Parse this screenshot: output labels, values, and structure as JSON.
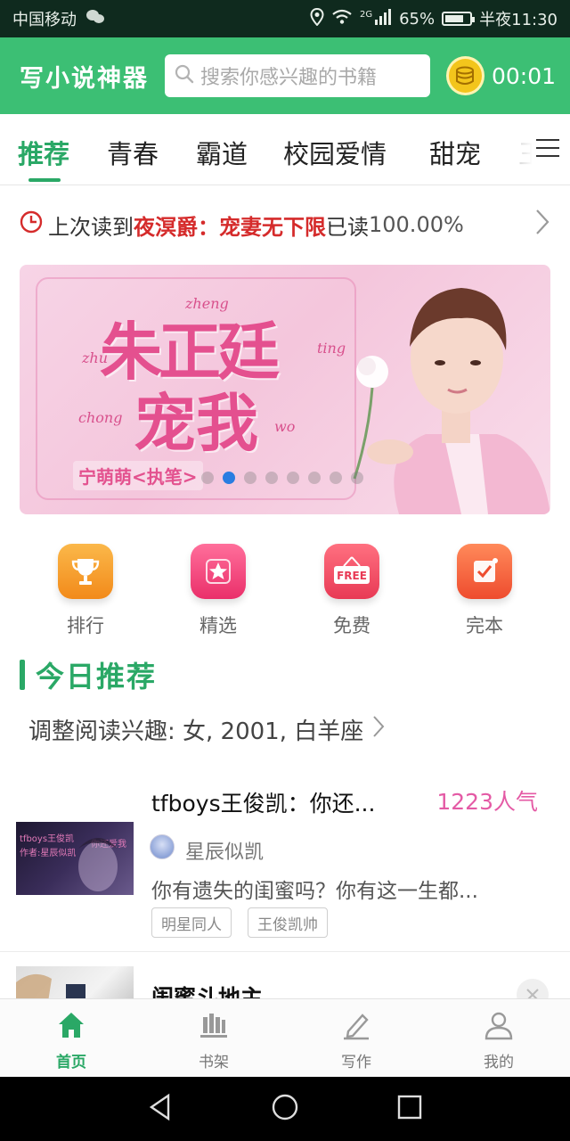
{
  "status_bar": {
    "carrier": "中国移动",
    "network": "2G",
    "battery": "65%",
    "time": "半夜11:30"
  },
  "header": {
    "app_title": "写小说神器",
    "search_placeholder": "搜索你感兴趣的书籍",
    "timer": "00:01"
  },
  "tabs": [
    "推荐",
    "青春",
    "霸道",
    "校园爱情",
    "甜宠",
    "王"
  ],
  "last_read": {
    "prefix": "上次读到",
    "book": "夜溟爵：宠妻无下限",
    "suffix": "已读",
    "percent": "100.00%"
  },
  "banner": {
    "title_line1": "朱正廷",
    "title_line2": "宠我",
    "pinyin": [
      "zhu",
      "zheng",
      "ting",
      "chong",
      "wo"
    ],
    "author": "宁萌萌<执笔>",
    "slide_count": 8,
    "active_slide": 1
  },
  "quick_entries": [
    {
      "label": "排行",
      "icon": "trophy-icon",
      "color": "#f5a024"
    },
    {
      "label": "精选",
      "icon": "star-icon",
      "color": "#f2407a"
    },
    {
      "label": "免费",
      "icon": "free-sign-icon",
      "color": "#ef4a62",
      "icon_text": "FREE"
    },
    {
      "label": "完本",
      "icon": "check-note-icon",
      "color": "#f2643a"
    }
  ],
  "today": {
    "title": "今日推荐",
    "interest": "调整阅读兴趣: 女, 2001, 白羊座"
  },
  "books": [
    {
      "title": "tfboys王俊凯：你还...",
      "popularity": "1223人气",
      "author": "星辰似凯",
      "desc": "你有遗失的闺蜜吗？你有这一生都...",
      "tags": [
        "明星同人",
        "王俊凯帅"
      ],
      "cover_text": [
        "tfboys王俊凯",
        "作者:星辰似凯",
        "你还爱我"
      ]
    },
    {
      "title": "闺蜜斗地主"
    }
  ],
  "bottom_nav": [
    {
      "label": "首页",
      "icon": "home-icon",
      "active": true
    },
    {
      "label": "书架",
      "icon": "bookshelf-icon",
      "active": false
    },
    {
      "label": "写作",
      "icon": "pencil-icon",
      "active": false
    },
    {
      "label": "我的",
      "icon": "user-icon",
      "active": false
    }
  ],
  "colors": {
    "brand_green": "#3cbf74",
    "accent_green": "#2aa866",
    "highlight_red": "#d52b2b",
    "popularity_pink": "#e45aa5",
    "active_dot": "#2a7de1"
  }
}
